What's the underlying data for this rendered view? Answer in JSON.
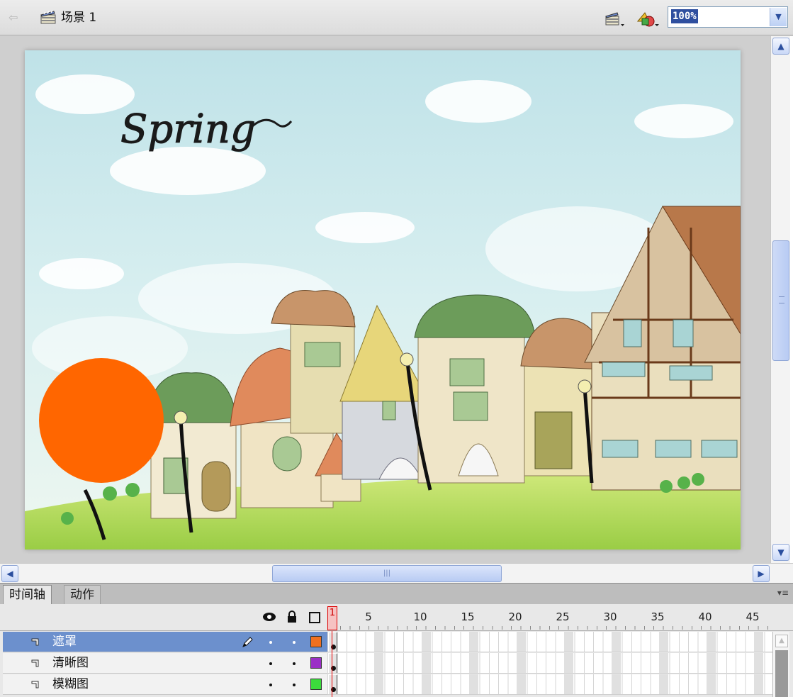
{
  "editbar": {
    "scene_label": "场景 1",
    "zoom_value": "100%",
    "icons": [
      "back-arrow-icon",
      "scene-clapper-icon",
      "edit-scene-icon",
      "edit-symbol-icon",
      "chevron-down-icon"
    ]
  },
  "stage": {
    "artwork_text": "Spring",
    "shapes": [
      {
        "name": "orange-circle",
        "color": "#ff6600"
      }
    ]
  },
  "panel": {
    "tabs": [
      "时间轴",
      "动作"
    ]
  },
  "timeline": {
    "playhead_label": "1",
    "ruler_labels": [
      "5",
      "10",
      "15",
      "20",
      "25",
      "30",
      "35",
      "40",
      "45"
    ],
    "layers": [
      {
        "name": "遮罩",
        "selected": true,
        "editing": true,
        "color": "#f07020"
      },
      {
        "name": "清晰图",
        "selected": false,
        "editing": false,
        "color": "#9b2fc6"
      },
      {
        "name": "模糊图",
        "selected": false,
        "editing": false,
        "color": "#3cdc3c"
      }
    ]
  },
  "colors": {
    "selection": "#6c90cd",
    "playhead": "#dd0000",
    "highlight": "#2f4f9f"
  }
}
